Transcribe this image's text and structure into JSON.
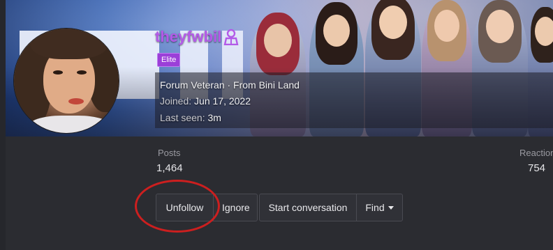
{
  "profile": {
    "username": "theyfwbil",
    "badge": "Elite",
    "title_line": "Forum Veteran · From Bini Land",
    "joined_label": "Joined:",
    "joined_value": "Jun 17, 2022",
    "last_seen_label": "Last seen:",
    "last_seen_value": "3m"
  },
  "stats": {
    "posts_label": "Posts",
    "posts_value": "1,464",
    "reactions_label": "Reaction",
    "reactions_value": "754"
  },
  "actions": {
    "unfollow": "Unfollow",
    "ignore": "Ignore",
    "start_conversation": "Start conversation",
    "find": "Find"
  },
  "colors": {
    "username": "#b35ae8",
    "badge_bg": "#9b3fd8",
    "annotation": "#cc1f1f",
    "page_bg": "#2b2c31"
  },
  "icons": {
    "user_icon": "person-bust-icon",
    "find_caret": "caret-down-icon"
  }
}
